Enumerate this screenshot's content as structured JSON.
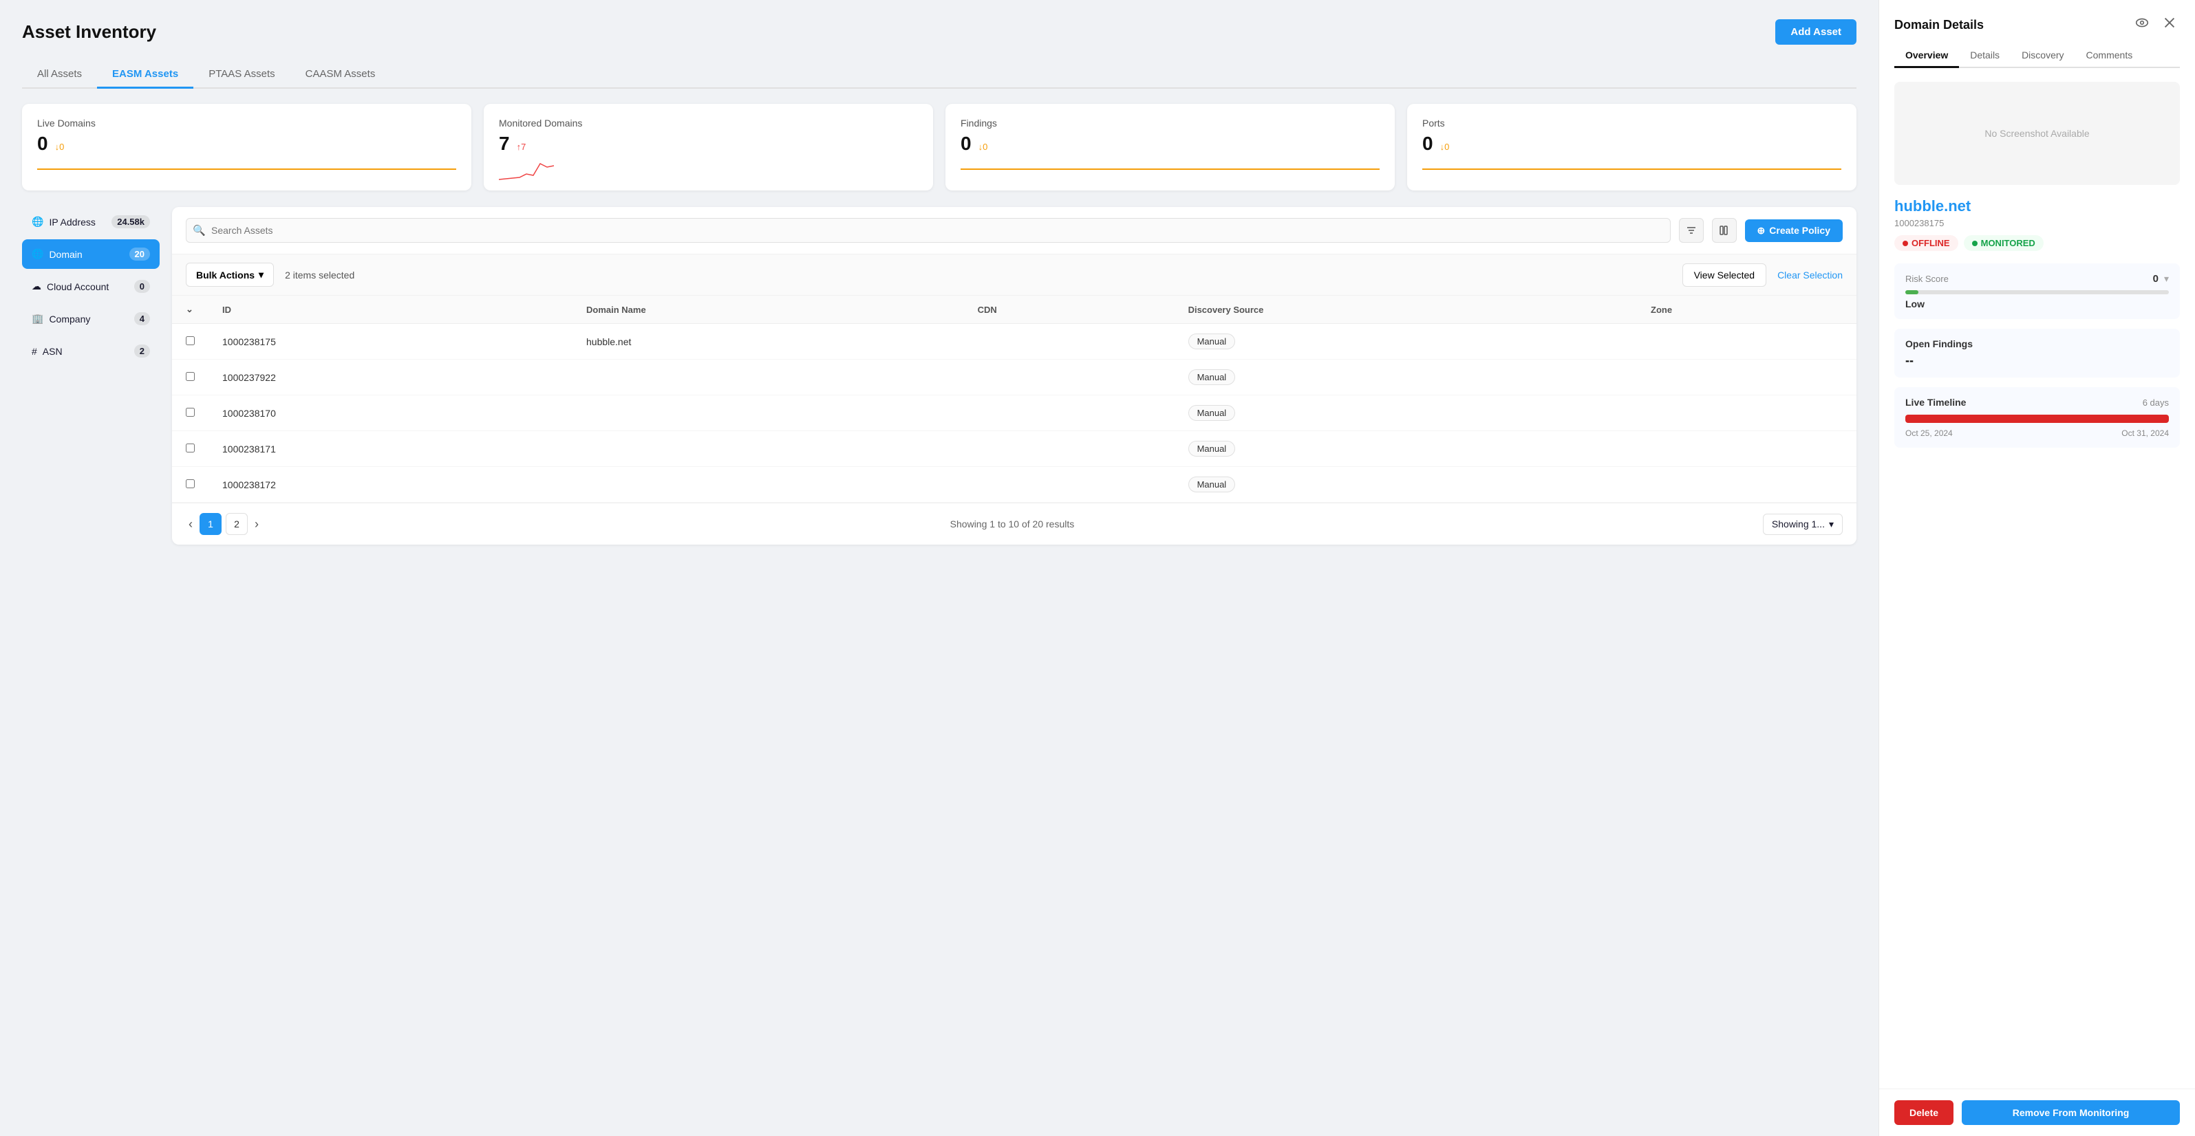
{
  "page": {
    "title": "Asset Inventory",
    "add_asset_btn": "Add Asset"
  },
  "tabs": [
    {
      "id": "all",
      "label": "All Assets",
      "active": false
    },
    {
      "id": "easm",
      "label": "EASM Assets",
      "active": true
    },
    {
      "id": "ptaas",
      "label": "PTAAS Assets",
      "active": false
    },
    {
      "id": "caasm",
      "label": "CAASM Assets",
      "active": false
    }
  ],
  "stats": [
    {
      "label": "Live Domains",
      "value": "0",
      "change": "↓0",
      "change_type": "down"
    },
    {
      "label": "Monitored Domains",
      "value": "7",
      "change": "↑7",
      "change_type": "up"
    },
    {
      "label": "Findings",
      "value": "0",
      "change": "↓0",
      "change_type": "down"
    },
    {
      "label": "Ports",
      "value": "0",
      "change": "↓0",
      "change_type": "down"
    }
  ],
  "filter_sidebar": {
    "items": [
      {
        "id": "ip",
        "icon": "🌐",
        "label": "IP Address",
        "count": "24.58k",
        "active": false
      },
      {
        "id": "domain",
        "icon": "🌐",
        "label": "Domain",
        "count": "20",
        "active": true
      },
      {
        "id": "cloud",
        "icon": "☁",
        "label": "Cloud Account",
        "count": "0",
        "active": false
      },
      {
        "id": "company",
        "icon": "🏢",
        "label": "Company",
        "count": "4",
        "active": false
      },
      {
        "id": "asn",
        "icon": "#",
        "label": "ASN",
        "count": "2",
        "active": false
      }
    ]
  },
  "table": {
    "search_placeholder": "Search Assets",
    "create_policy_btn": "Create Policy",
    "bulk_actions_btn": "Bulk Actions",
    "selected_count": "2 items selected",
    "view_selected_btn": "View Selected",
    "clear_selection": "Clear Selection",
    "columns": [
      "ID",
      "Domain Name",
      "CDN",
      "Discovery Source",
      "Zone"
    ],
    "rows": [
      {
        "id": "1000238175",
        "domain": "hubble.net",
        "cdn": "",
        "source": "Manual",
        "zone": "",
        "checked": false
      },
      {
        "id": "1000237922",
        "domain": "",
        "cdn": "",
        "source": "Manual",
        "zone": "",
        "checked": false
      },
      {
        "id": "1000238170",
        "domain": "",
        "cdn": "",
        "source": "Manual",
        "zone": "",
        "checked": false
      },
      {
        "id": "1000238171",
        "domain": "",
        "cdn": "",
        "source": "Manual",
        "zone": "",
        "checked": false
      },
      {
        "id": "1000238172",
        "domain": "",
        "cdn": "",
        "source": "Manual",
        "zone": "",
        "checked": false
      }
    ],
    "pagination": {
      "prev_btn": "‹",
      "pages": [
        "1",
        "2"
      ],
      "next_btn": "›",
      "showing_info": "Showing 1 to 10 of 20 results",
      "showing_dropdown": "Showing 1..."
    }
  },
  "domain_panel": {
    "title": "Domain Details",
    "tabs": [
      {
        "label": "Overview",
        "active": true
      },
      {
        "label": "Details",
        "active": false
      },
      {
        "label": "Discovery",
        "active": false
      },
      {
        "label": "Comments",
        "active": false
      }
    ],
    "screenshot_text": "No Screenshot Available",
    "domain_name": "hubble.net",
    "domain_id": "1000238175",
    "statuses": [
      {
        "label": "OFFLINE",
        "type": "offline"
      },
      {
        "label": "MONITORED",
        "type": "monitored"
      }
    ],
    "risk": {
      "label": "Risk Score",
      "level": "Low",
      "value": "0"
    },
    "findings": {
      "title": "Open Findings",
      "value": "--"
    },
    "timeline": {
      "title": "Live Timeline",
      "days": "6 days",
      "start_date": "Oct 25, 2024",
      "end_date": "Oct 31, 2024"
    },
    "delete_btn": "Delete",
    "remove_monitoring_btn": "Remove From Monitoring"
  }
}
